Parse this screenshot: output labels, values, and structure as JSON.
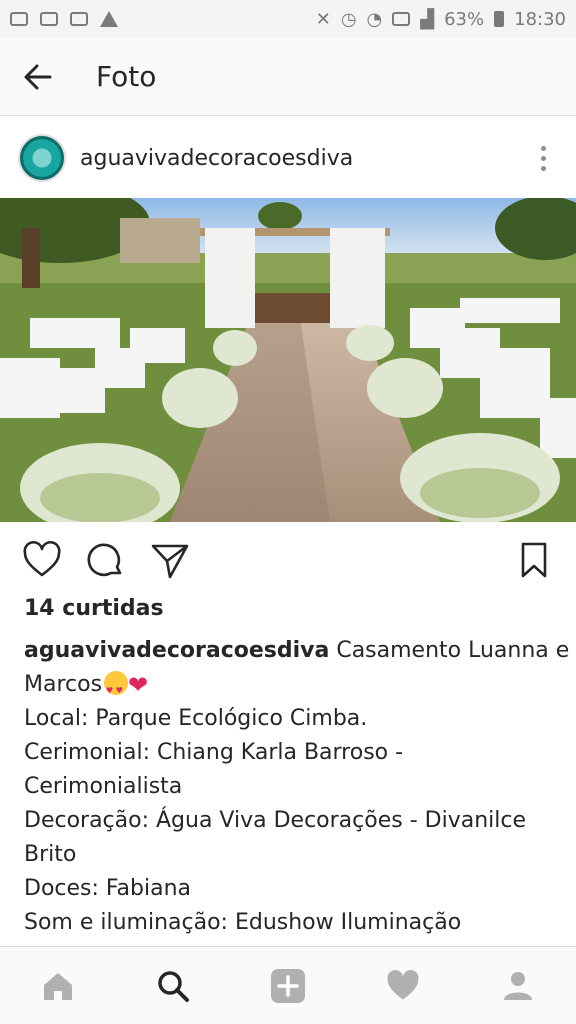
{
  "status_bar": {
    "battery": "63%",
    "time": "18:30"
  },
  "app_bar": {
    "title": "Foto"
  },
  "post": {
    "username": "aguavivadecoracoesdiva",
    "likes": "14 curtidas",
    "caption": {
      "username": "aguavivadecoracoesdiva",
      "line1_text": "Casamento Luanna e",
      "line2_text": "Marcos",
      "line3": "Local: Parque Ecológico Cimba.",
      "line4": "Cerimonial: Chiang Karla Barroso -",
      "line5": "Cerimonialista",
      "line6": "Decoração: Água Viva Decorações - Divanilce",
      "line7": "Brito",
      "line8": "Doces: Fabiana",
      "line9": "Som e iluminação: Edushow Iluminação"
    }
  },
  "icons": {
    "back": "arrow-left-icon",
    "more": "more-vertical-icon",
    "like": "heart-outline-icon",
    "comment": "comment-icon",
    "share": "send-icon",
    "save": "bookmark-icon",
    "nav": [
      "home-icon",
      "search-icon",
      "add-icon",
      "activity-heart-icon",
      "profile-icon"
    ]
  },
  "colors": {
    "text": "#262626",
    "icon_grey": "#b0b0b0",
    "active": "#262626",
    "heart_emoji": "#e0245e"
  }
}
